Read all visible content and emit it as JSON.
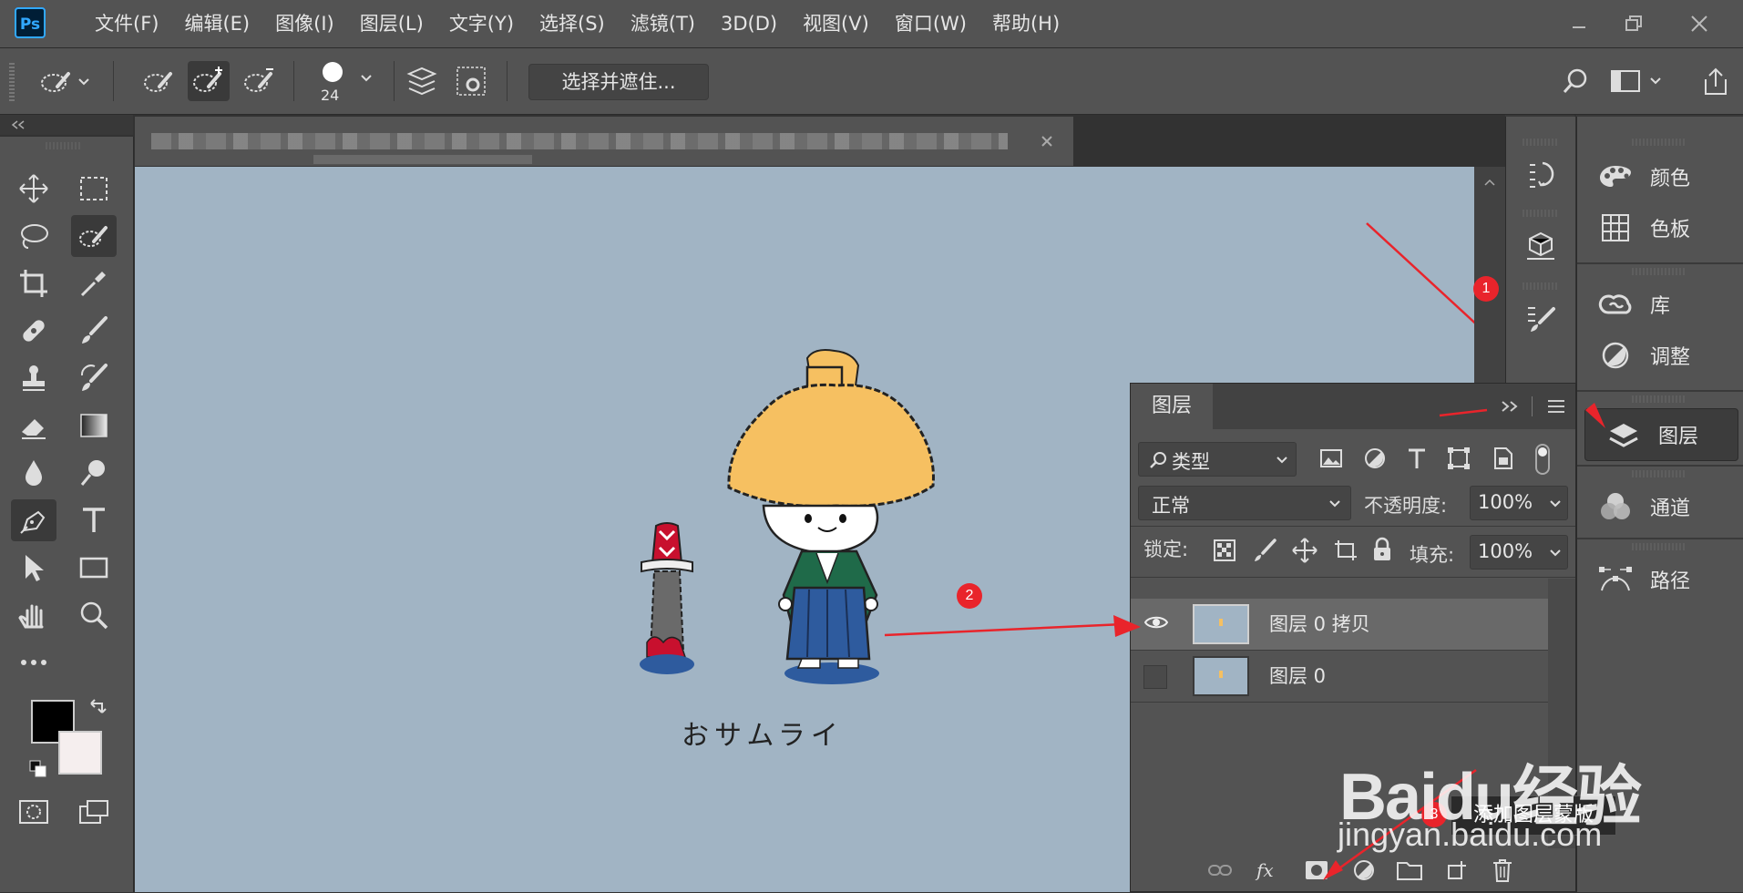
{
  "app": {
    "logo_text": "Ps"
  },
  "menu": [
    "文件(F)",
    "编辑(E)",
    "图像(I)",
    "图层(L)",
    "文字(Y)",
    "选择(S)",
    "滤镜(T)",
    "3D(D)",
    "视图(V)",
    "窗口(W)",
    "帮助(H)"
  ],
  "options_bar": {
    "brush_size": "24",
    "select_and_mask_label": "选择并遮住..."
  },
  "canvas": {
    "background_color": "#a1b4c4",
    "artwork_caption": "おサムライ",
    "hat_color": "#f6c061",
    "kimono_color": "#1f6a49",
    "hakama_color": "#2e5b9e",
    "sword_handle_color": "#c8102e"
  },
  "right_dock": [
    {
      "label": "颜色",
      "icon": "palette-icon"
    },
    {
      "label": "色板",
      "icon": "grid-icon"
    },
    {
      "label": "库",
      "icon": "cc-libraries-icon"
    },
    {
      "label": "调整",
      "icon": "adjustment-icon"
    },
    {
      "label": "图层",
      "icon": "layers-icon",
      "active": true
    },
    {
      "label": "通道",
      "icon": "channels-icon"
    },
    {
      "label": "路径",
      "icon": "paths-icon"
    }
  ],
  "layers_panel": {
    "tab_label": "图层",
    "filter_label": "类型",
    "blend_mode": "正常",
    "opacity_label": "不透明度:",
    "opacity_value": "100%",
    "lock_label": "锁定:",
    "fill_label": "填充:",
    "fill_value": "100%",
    "layers": [
      {
        "name": "图层 0 拷贝",
        "visible": true,
        "selected": true
      },
      {
        "name": "图层 0",
        "visible": false,
        "selected": false
      }
    ]
  },
  "annotations": {
    "step1": "1",
    "step2": "2",
    "step3": "3",
    "tooltip": "添加图层蒙版",
    "arrow_color": "#e9242b"
  },
  "watermark": {
    "brand": "Baidu经验",
    "url": "jingyan.baidu.com"
  },
  "colors": {
    "foreground": "#000000",
    "background": "#f5eeee"
  }
}
